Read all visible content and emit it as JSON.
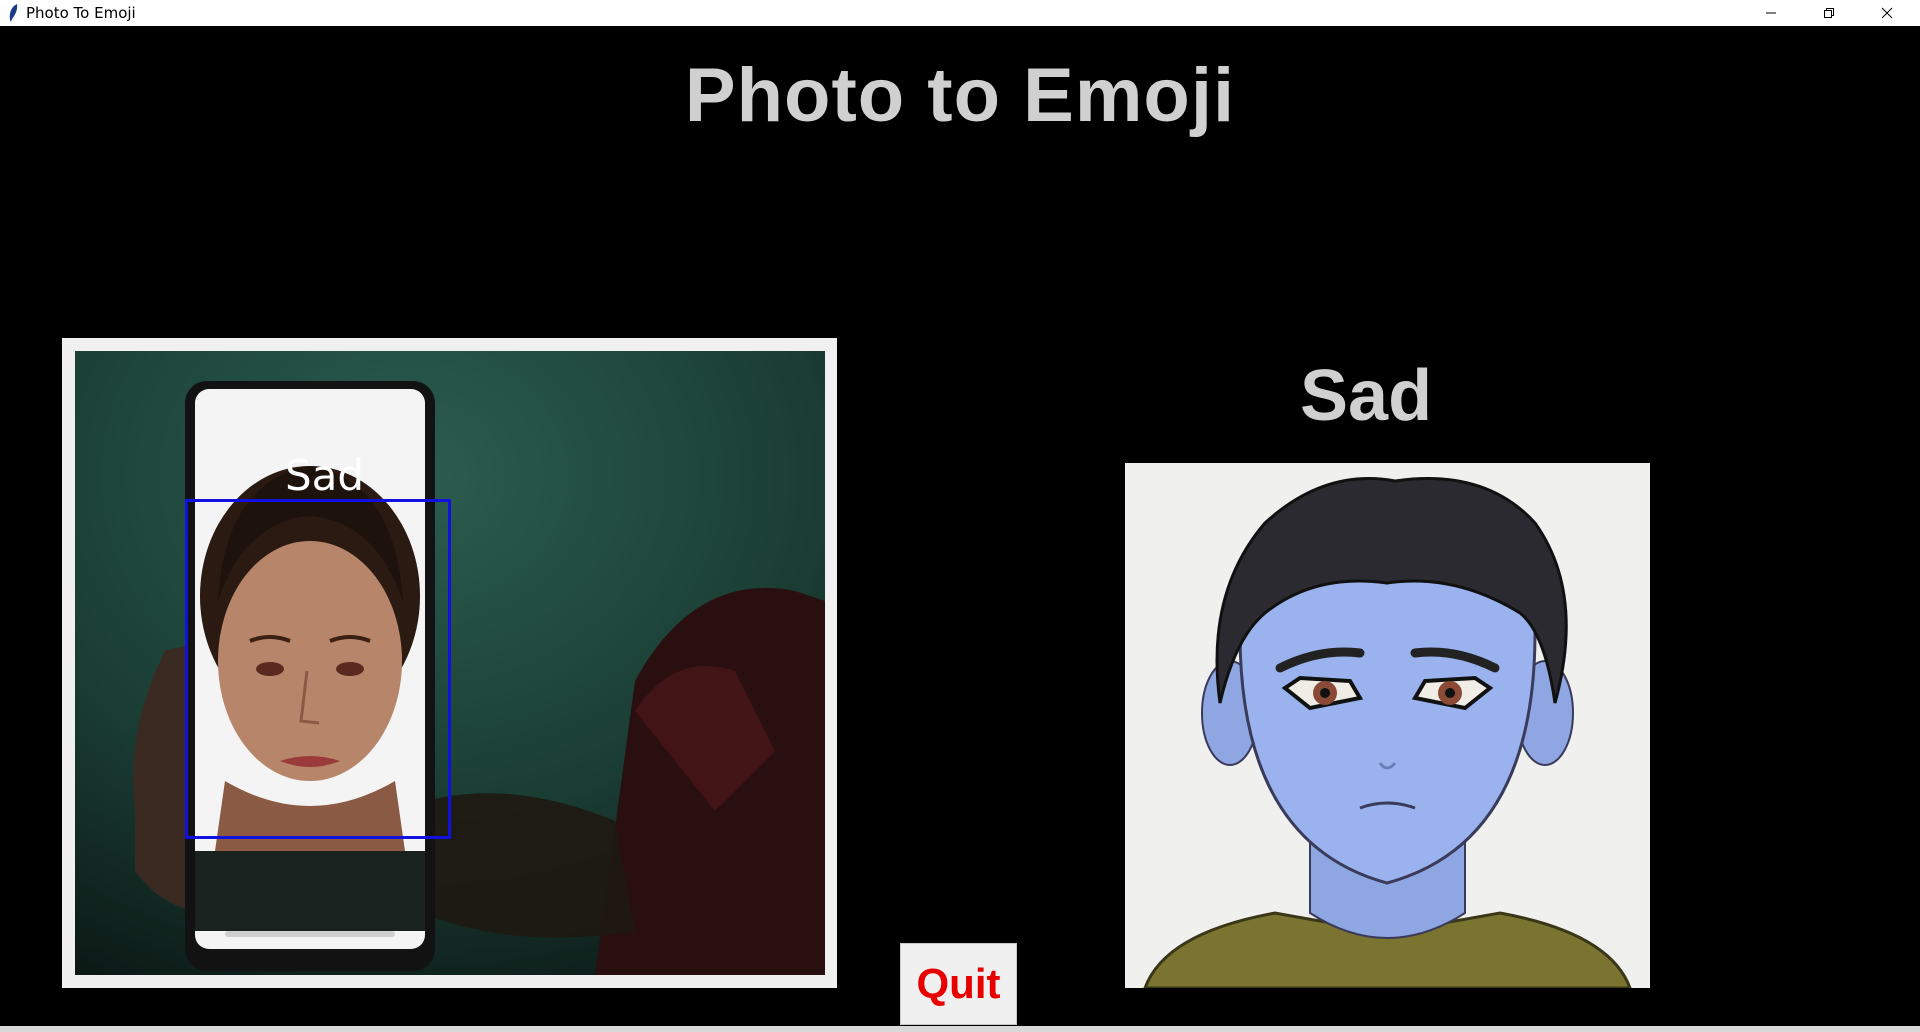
{
  "window": {
    "title": "Photo To Emoji",
    "controls": [
      "minimize-icon",
      "restore-icon",
      "close-icon"
    ]
  },
  "app": {
    "heading": "Photo to Emoji",
    "emotion": "Sad",
    "camera_overlay_label": "Sad",
    "quit_label": "Quit"
  },
  "colors": {
    "background": "#000000",
    "heading_text": "#d0d0d0",
    "quit_text": "#e80000",
    "face_box": "#1010e0",
    "emoji_skin": "#9ab3ee"
  }
}
